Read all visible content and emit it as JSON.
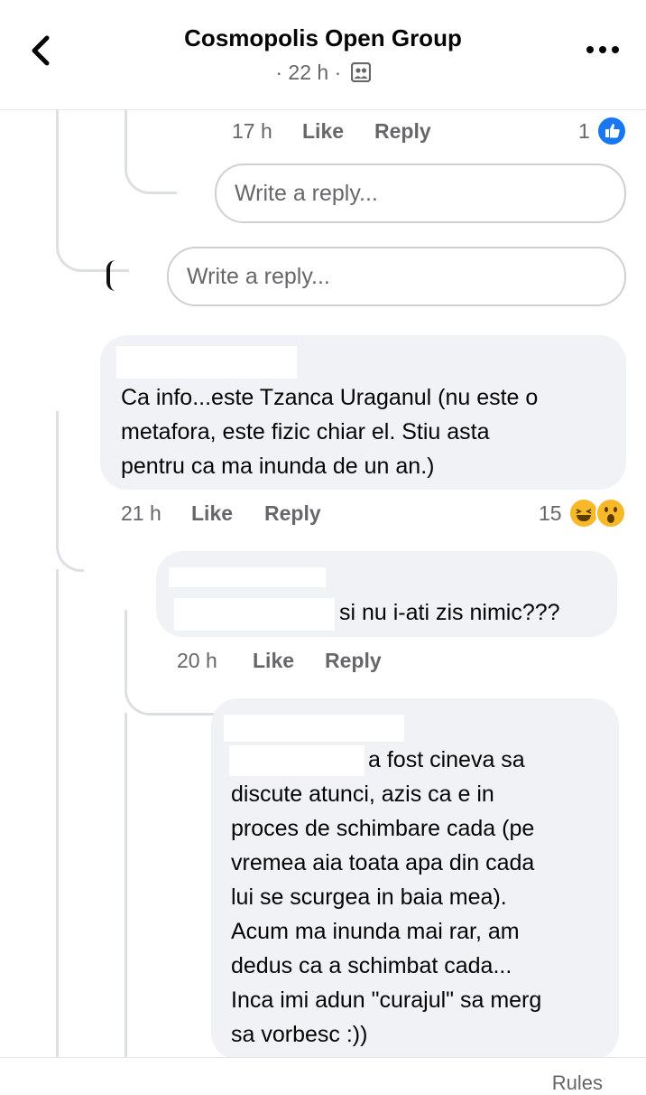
{
  "header": {
    "title": "Cosmopolis Open Group",
    "time": "22 h",
    "sep": "·"
  },
  "actions": {
    "like": "Like",
    "reply": "Reply"
  },
  "prev_reply": {
    "time": "17 h",
    "reaction_count": "1"
  },
  "reply_inputs": {
    "placeholder": "Write a reply..."
  },
  "comments": [
    {
      "text_lines": [
        "Ca info...este Tzanca Uraganul (nu este o",
        "metafora, este fizic chiar el. Stiu asta",
        "pentru ca ma inunda de un an.)"
      ],
      "time": "21 h",
      "reaction_count": "15"
    },
    {
      "text_lines": [
        "si nu i-ati zis nimic???"
      ],
      "time": "20 h"
    },
    {
      "text_lines": [
        "a fost cineva sa",
        "discute atunci, azis ca e in",
        "proces de schimbare cada (pe",
        "vremea aia toata apa din cada",
        "lui se scurgea in baia mea).",
        "Acum ma inunda mai rar, am",
        "dedus ca a schimbat cada...",
        "Inca imi adun \"curajul\" sa merg",
        "sa vorbesc :))"
      ]
    }
  ],
  "footer": {
    "rules": "Rules"
  },
  "colors": {
    "like_blue": "#1877f2",
    "haha_yellow": "#f7b928",
    "bubble_bg": "#f0f2f5",
    "meta_gray": "#65676b"
  },
  "icons": [
    "back-chevron-icon",
    "group-members-icon",
    "more-dots-icon",
    "like-reaction-icon",
    "haha-reaction-icon",
    "wow-reaction-icon"
  ]
}
